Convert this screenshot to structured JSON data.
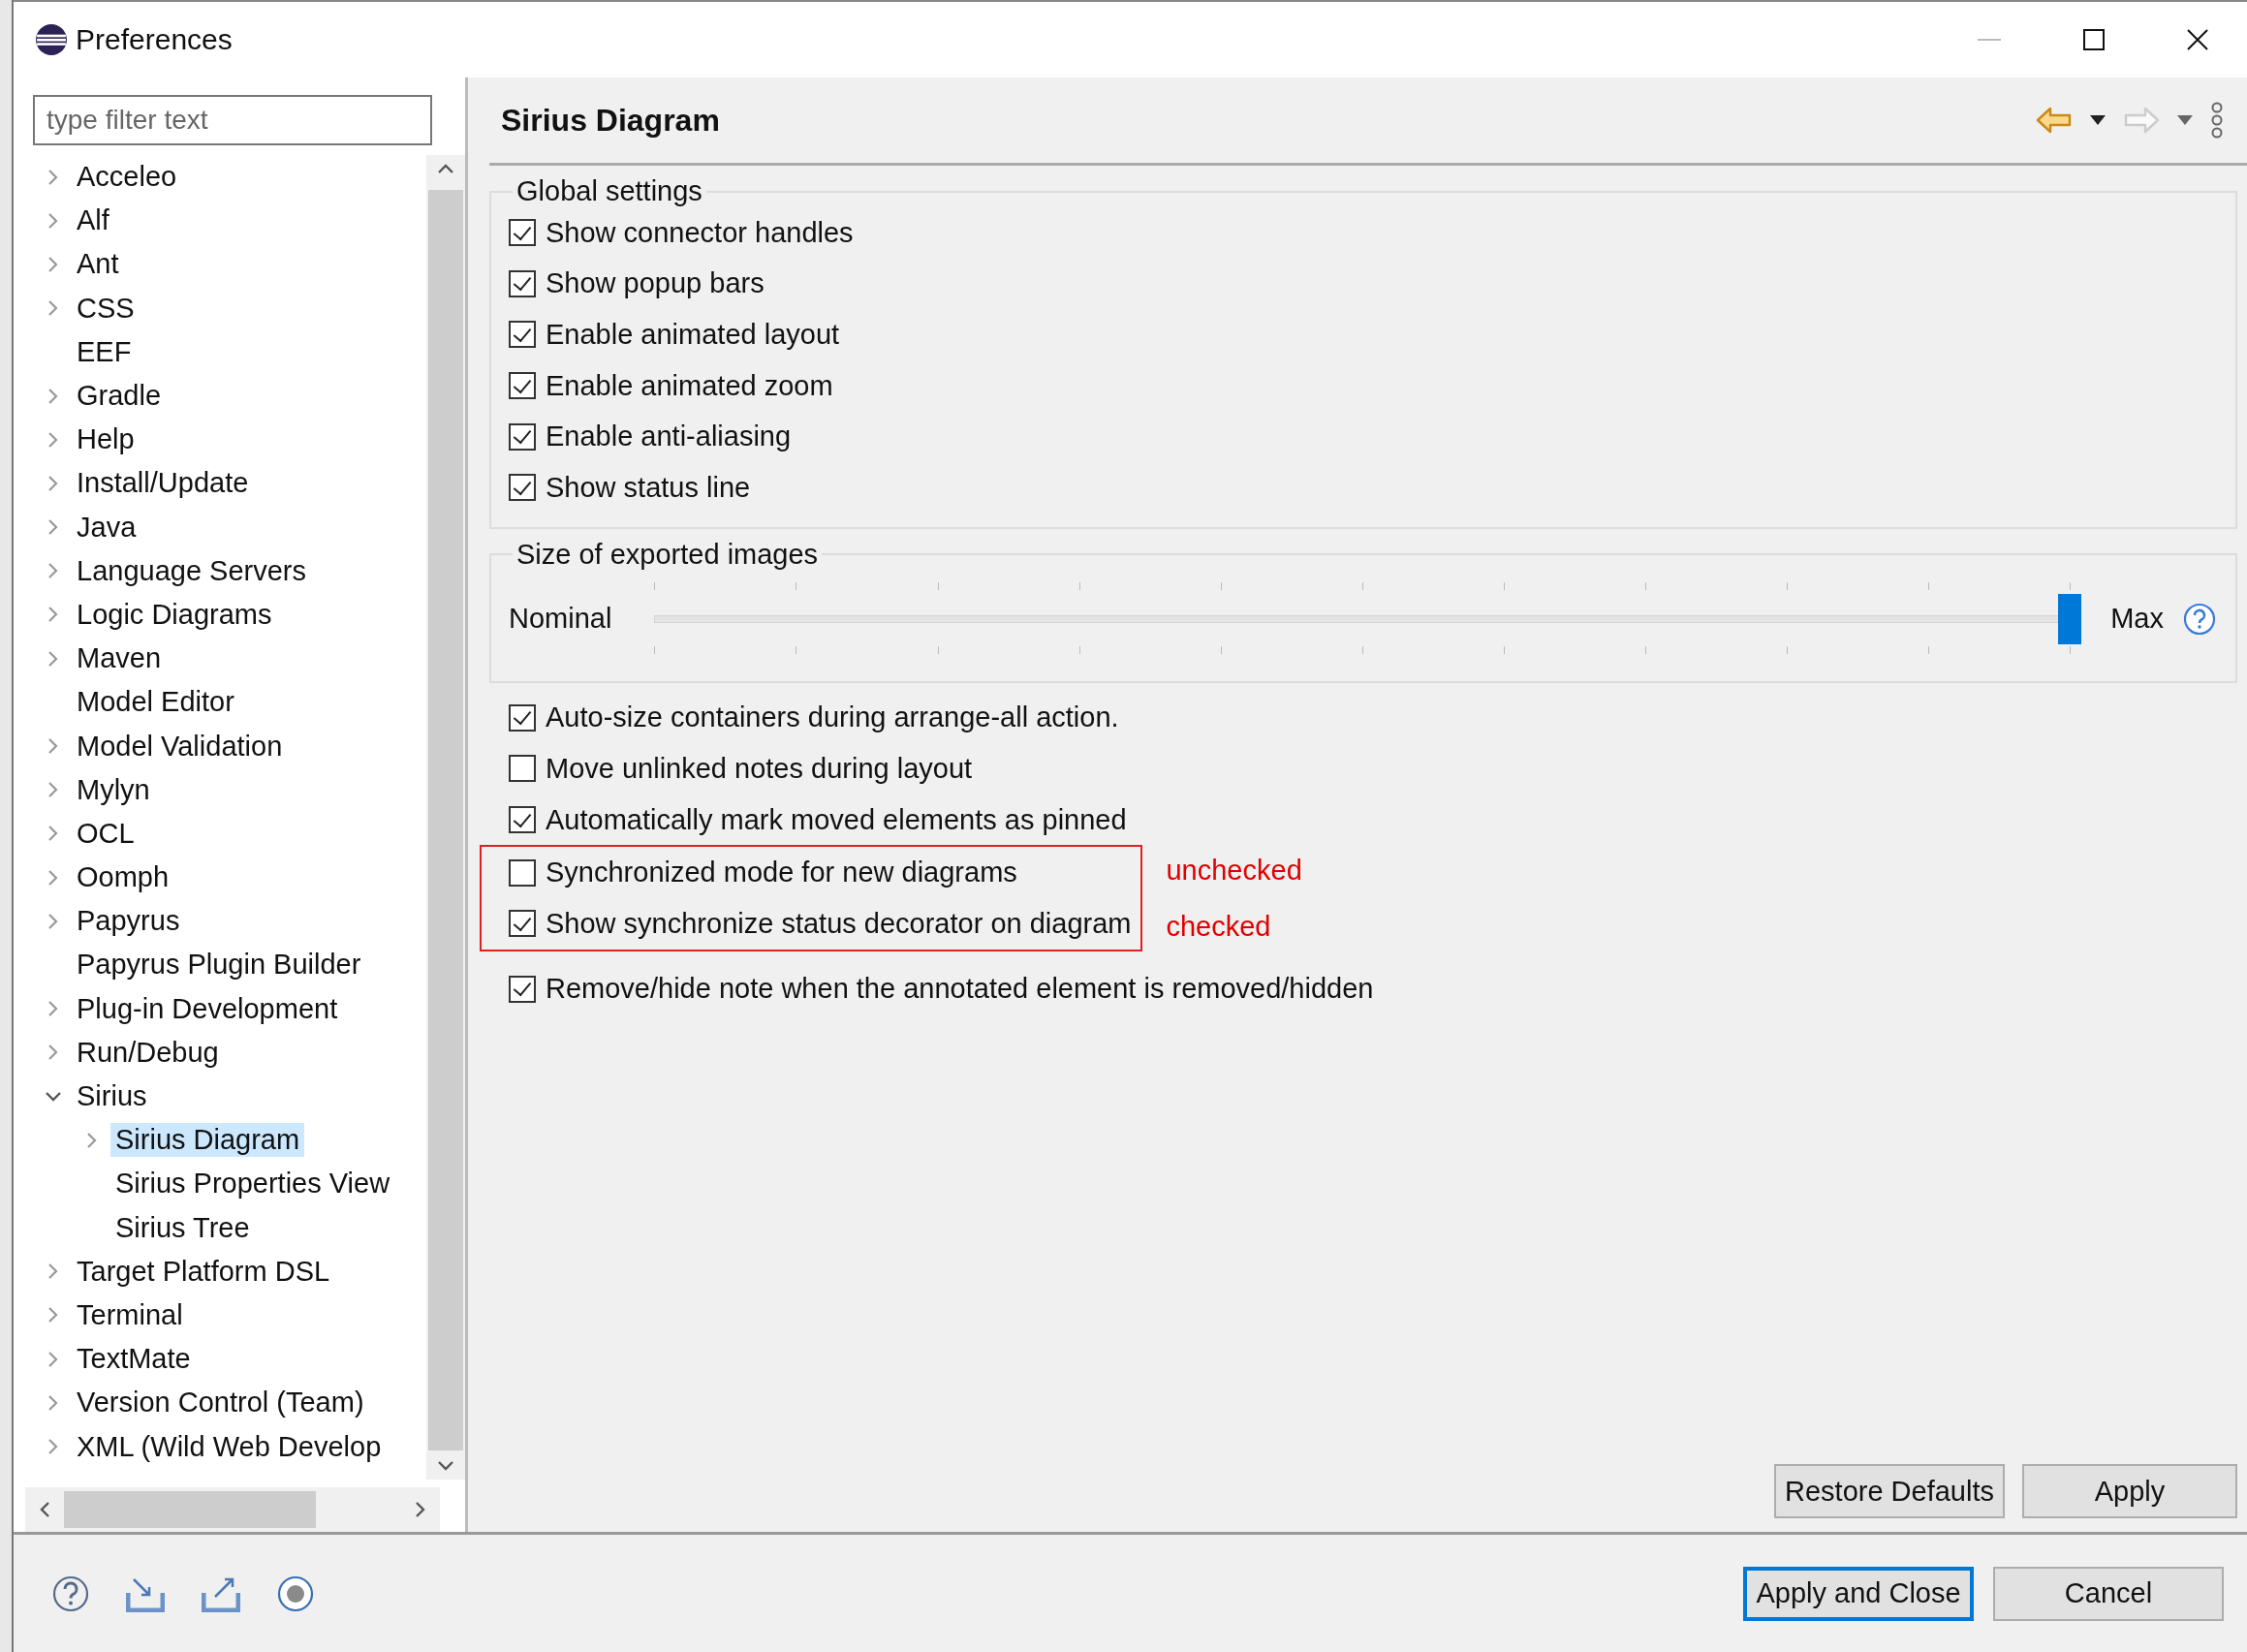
{
  "window": {
    "title": "Preferences"
  },
  "filter": {
    "placeholder": "type filter text"
  },
  "tree": {
    "items": [
      {
        "label": "Acceleo",
        "expanded": false,
        "selected": false
      },
      {
        "label": "Alf",
        "expanded": false,
        "selected": false
      },
      {
        "label": "Ant",
        "expanded": false,
        "selected": false
      },
      {
        "label": "CSS",
        "expanded": false,
        "selected": false
      },
      {
        "label": "EEF",
        "selected": false
      },
      {
        "label": "Gradle",
        "expanded": false,
        "selected": false
      },
      {
        "label": "Help",
        "expanded": false,
        "selected": false
      },
      {
        "label": "Install/Update",
        "expanded": false,
        "selected": false
      },
      {
        "label": "Java",
        "expanded": false,
        "selected": false
      },
      {
        "label": "Language Servers",
        "expanded": false,
        "selected": false
      },
      {
        "label": "Logic Diagrams",
        "expanded": false,
        "selected": false
      },
      {
        "label": "Maven",
        "expanded": false,
        "selected": false
      },
      {
        "label": "Model Editor",
        "selected": false
      },
      {
        "label": "Model Validation",
        "expanded": false,
        "selected": false
      },
      {
        "label": "Mylyn",
        "expanded": false,
        "selected": false
      },
      {
        "label": "OCL",
        "expanded": false,
        "selected": false
      },
      {
        "label": "Oomph",
        "expanded": false,
        "selected": false
      },
      {
        "label": "Papyrus",
        "expanded": false,
        "selected": false
      },
      {
        "label": "Papyrus Plugin Builder",
        "selected": false
      },
      {
        "label": "Plug-in Development",
        "expanded": false,
        "selected": false
      },
      {
        "label": "Run/Debug",
        "expanded": false,
        "selected": false
      },
      {
        "label": "Sirius",
        "expanded": true,
        "selected": false,
        "children": [
          {
            "label": "Sirius Diagram",
            "expanded": false,
            "selected": true
          },
          {
            "label": "Sirius Properties View",
            "selected": false
          },
          {
            "label": "Sirius Tree",
            "selected": false
          }
        ]
      },
      {
        "label": "Target Platform DSL",
        "expanded": false,
        "selected": false
      },
      {
        "label": "Terminal",
        "expanded": false,
        "selected": false
      },
      {
        "label": "TextMate",
        "expanded": false,
        "selected": false
      },
      {
        "label": "Version Control (Team)",
        "expanded": false,
        "selected": false
      },
      {
        "label": "XML (Wild Web Develop",
        "expanded": false,
        "selected": false
      }
    ]
  },
  "page": {
    "title": "Sirius Diagram"
  },
  "global_settings": {
    "title": "Global settings",
    "options": [
      {
        "label": "Show connector handles",
        "checked": true
      },
      {
        "label": "Show popup bars",
        "checked": true
      },
      {
        "label": "Enable animated layout",
        "checked": true
      },
      {
        "label": "Enable animated zoom",
        "checked": true
      },
      {
        "label": "Enable anti-aliasing",
        "checked": true
      },
      {
        "label": "Show status line",
        "checked": true
      }
    ]
  },
  "exported_images": {
    "title": "Size of exported images",
    "min_label": "Nominal",
    "max_label": "Max",
    "slider": {
      "level": 1
    }
  },
  "options": [
    {
      "label": "Auto-size containers during arrange-all action.",
      "checked": true
    },
    {
      "label": "Move unlinked notes during layout",
      "checked": false
    },
    {
      "label": "Automatically mark moved elements as pinned",
      "checked": true
    }
  ],
  "highlighted_options": [
    {
      "label": "Synchronized mode for new diagrams",
      "checked": false,
      "note": "unchecked"
    },
    {
      "label": "Show synchronize status decorator on diagram",
      "checked": true,
      "note": "checked"
    }
  ],
  "options_after": [
    {
      "label": "Remove/hide note when the annotated element is removed/hidden",
      "checked": true
    }
  ],
  "page_buttons": [
    "Restore Defaults",
    "Apply"
  ],
  "dialog_buttons": [
    {
      "label": "Apply and Close",
      "default": true
    },
    {
      "label": "Cancel",
      "default": false
    }
  ]
}
